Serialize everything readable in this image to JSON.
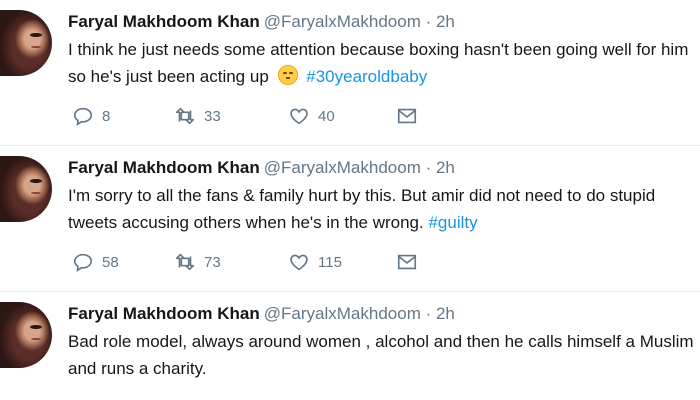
{
  "tweets": [
    {
      "name": "Faryal Makhdoom Khan",
      "handle": "@FaryalxMakhdoom",
      "time": "· 2h",
      "text_part1": "I think he just needs some attention because boxing hasn't been going well for him so he's just been acting up",
      "emoji": "smirk-emoji",
      "hashtag": "#30yearoldbaby",
      "reply_count": "8",
      "retweet_count": "33",
      "like_count": "40"
    },
    {
      "name": "Faryal Makhdoom Khan",
      "handle": "@FaryalxMakhdoom",
      "time": "· 2h",
      "text_part1": "I'm sorry to all the fans & family hurt by this. But amir did not need to do stupid tweets accusing others when he's in the wrong.",
      "hashtag": "#guilty",
      "reply_count": "58",
      "retweet_count": "73",
      "like_count": "115"
    },
    {
      "name": "Faryal Makhdoom Khan",
      "handle": "@FaryalxMakhdoom",
      "time": "· 2h",
      "text_part1": "Bad role model, always around women , alcohol and then he calls himself a Muslim and runs a charity."
    }
  ],
  "icons": {
    "reply": "reply-icon",
    "retweet": "retweet-icon",
    "like": "heart-icon",
    "dm": "envelope-icon"
  },
  "colors": {
    "hashtag": "#1b95e0",
    "secondary_text": "#657786"
  }
}
